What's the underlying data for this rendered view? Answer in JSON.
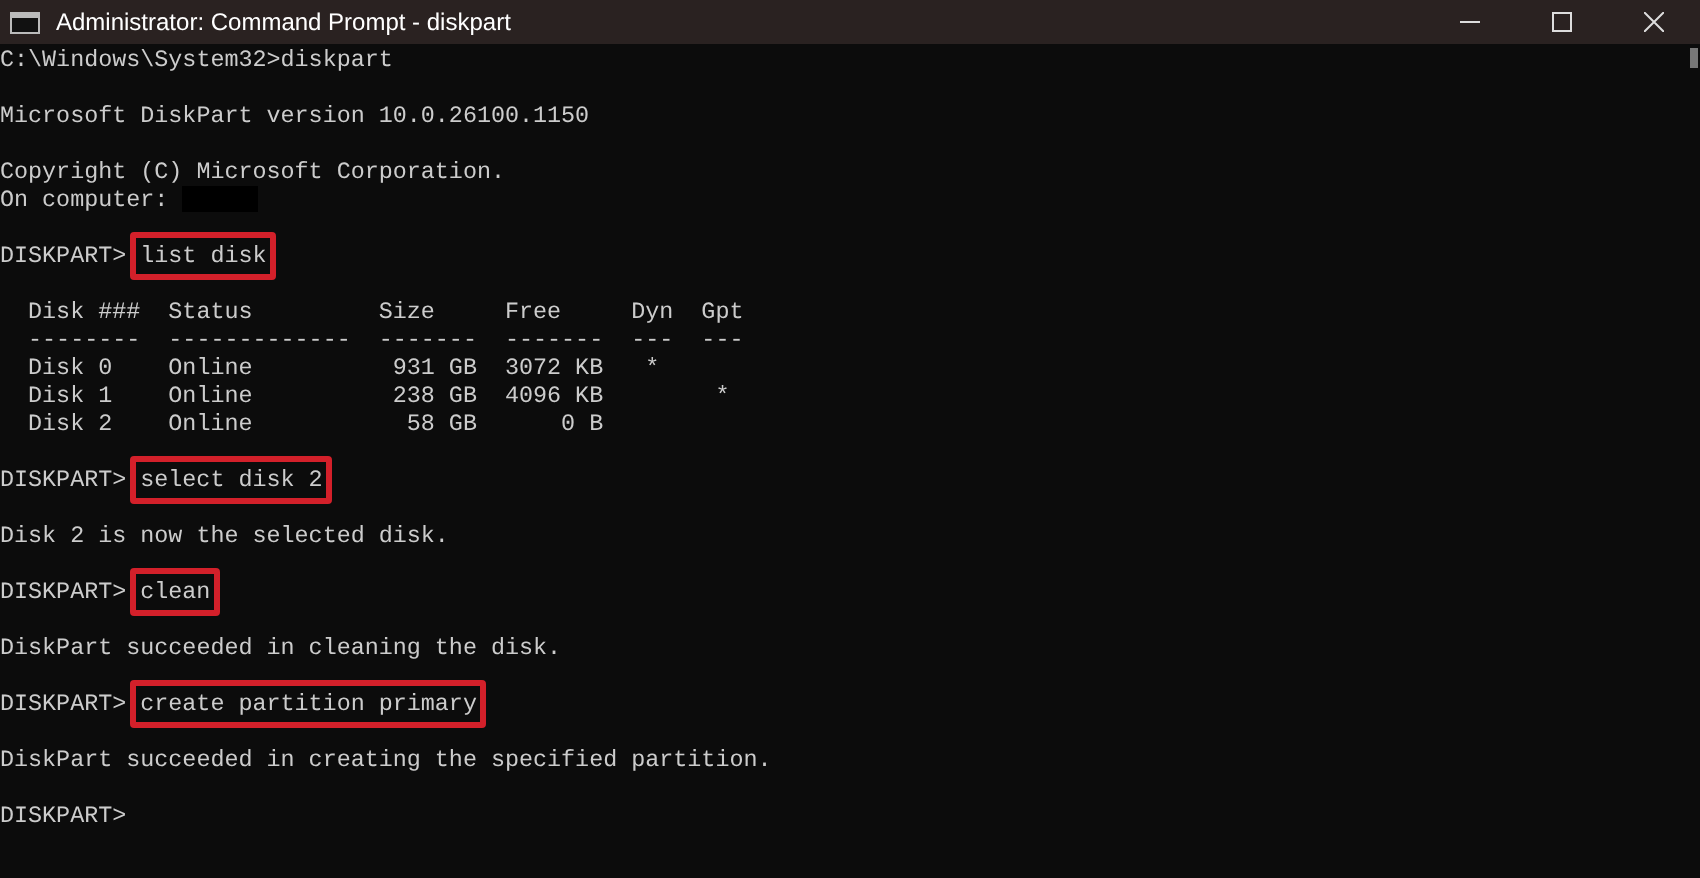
{
  "window": {
    "title": "Administrator: Command Prompt - diskpart"
  },
  "lines": [
    {
      "kind": "text",
      "text": "C:\\Windows\\System32>diskpart"
    },
    {
      "kind": "blank"
    },
    {
      "kind": "text",
      "text": "Microsoft DiskPart version 10.0.26100.1150"
    },
    {
      "kind": "blank"
    },
    {
      "kind": "text",
      "text": "Copyright (C) Microsoft Corporation."
    },
    {
      "kind": "redacted",
      "text": "On computer: "
    },
    {
      "kind": "blank"
    },
    {
      "kind": "command",
      "prompt": "DISKPART>",
      "command": "list disk",
      "highlighted": true
    },
    {
      "kind": "blank"
    },
    {
      "kind": "text",
      "text": "  Disk ###  Status         Size     Free     Dyn  Gpt"
    },
    {
      "kind": "text",
      "text": "  --------  -------------  -------  -------  ---  ---"
    },
    {
      "kind": "text",
      "text": "  Disk 0    Online          931 GB  3072 KB   *"
    },
    {
      "kind": "text",
      "text": "  Disk 1    Online          238 GB  4096 KB        *"
    },
    {
      "kind": "text",
      "text": "  Disk 2    Online           58 GB      0 B"
    },
    {
      "kind": "blank"
    },
    {
      "kind": "command",
      "prompt": "DISKPART>",
      "command": "select disk 2",
      "highlighted": true
    },
    {
      "kind": "blank"
    },
    {
      "kind": "text",
      "text": "Disk 2 is now the selected disk."
    },
    {
      "kind": "blank"
    },
    {
      "kind": "command",
      "prompt": "DISKPART>",
      "command": "clean",
      "highlighted": true
    },
    {
      "kind": "blank"
    },
    {
      "kind": "text",
      "text": "DiskPart succeeded in cleaning the disk."
    },
    {
      "kind": "blank"
    },
    {
      "kind": "command",
      "prompt": "DISKPART>",
      "command": "create partition primary",
      "highlighted": true
    },
    {
      "kind": "blank"
    },
    {
      "kind": "text",
      "text": "DiskPart succeeded in creating the specified partition."
    },
    {
      "kind": "blank"
    },
    {
      "kind": "text",
      "text": "DISKPART>"
    }
  ]
}
